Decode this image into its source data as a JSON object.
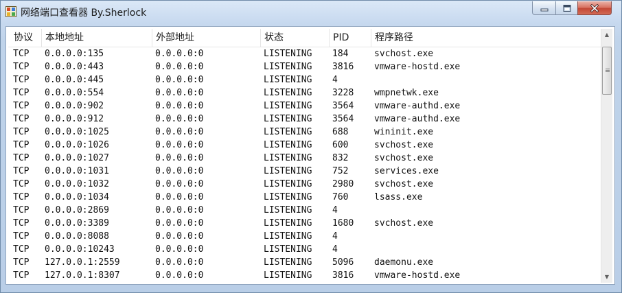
{
  "window": {
    "title": "网络端口查看器 By.Sherlock",
    "icon": "app-grid-icon",
    "colors": {
      "title_bg": "#c9d9ee",
      "close_button": "#c24634"
    }
  },
  "list": {
    "columns": [
      "协议",
      "本地地址",
      "外部地址",
      "状态",
      "PID",
      "程序路径"
    ],
    "rows": [
      [
        "TCP",
        "0.0.0.0:135",
        "0.0.0.0:0",
        "LISTENING",
        "184",
        "svchost.exe"
      ],
      [
        "TCP",
        "0.0.0.0:443",
        "0.0.0.0:0",
        "LISTENING",
        "3816",
        "vmware-hostd.exe"
      ],
      [
        "TCP",
        "0.0.0.0:445",
        "0.0.0.0:0",
        "LISTENING",
        "4",
        ""
      ],
      [
        "TCP",
        "0.0.0.0:554",
        "0.0.0.0:0",
        "LISTENING",
        "3228",
        "wmpnetwk.exe"
      ],
      [
        "TCP",
        "0.0.0.0:902",
        "0.0.0.0:0",
        "LISTENING",
        "3564",
        "vmware-authd.exe"
      ],
      [
        "TCP",
        "0.0.0.0:912",
        "0.0.0.0:0",
        "LISTENING",
        "3564",
        "vmware-authd.exe"
      ],
      [
        "TCP",
        "0.0.0.0:1025",
        "0.0.0.0:0",
        "LISTENING",
        "688",
        "wininit.exe"
      ],
      [
        "TCP",
        "0.0.0.0:1026",
        "0.0.0.0:0",
        "LISTENING",
        "600",
        "svchost.exe"
      ],
      [
        "TCP",
        "0.0.0.0:1027",
        "0.0.0.0:0",
        "LISTENING",
        "832",
        "svchost.exe"
      ],
      [
        "TCP",
        "0.0.0.0:1031",
        "0.0.0.0:0",
        "LISTENING",
        "752",
        "services.exe"
      ],
      [
        "TCP",
        "0.0.0.0:1032",
        "0.0.0.0:0",
        "LISTENING",
        "2980",
        "svchost.exe"
      ],
      [
        "TCP",
        "0.0.0.0:1034",
        "0.0.0.0:0",
        "LISTENING",
        "760",
        "lsass.exe"
      ],
      [
        "TCP",
        "0.0.0.0:2869",
        "0.0.0.0:0",
        "LISTENING",
        "4",
        ""
      ],
      [
        "TCP",
        "0.0.0.0:3389",
        "0.0.0.0:0",
        "LISTENING",
        "1680",
        "svchost.exe"
      ],
      [
        "TCP",
        "0.0.0.0:8088",
        "0.0.0.0:0",
        "LISTENING",
        "4",
        ""
      ],
      [
        "TCP",
        "0.0.0.0:10243",
        "0.0.0.0:0",
        "LISTENING",
        "4",
        ""
      ],
      [
        "TCP",
        "127.0.0.1:2559",
        "0.0.0.0:0",
        "LISTENING",
        "5096",
        "daemonu.exe"
      ],
      [
        "TCP",
        "127.0.0.1:8307",
        "0.0.0.0:0",
        "LISTENING",
        "3816",
        "vmware-hostd.exe"
      ]
    ]
  }
}
